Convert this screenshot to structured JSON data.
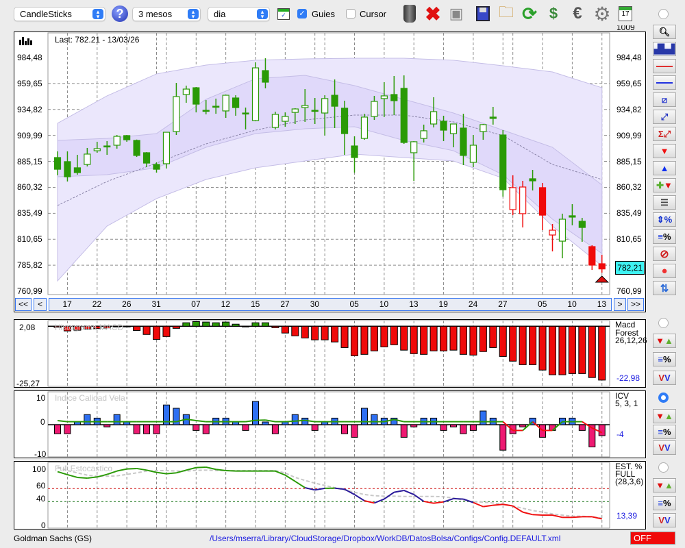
{
  "toolbar": {
    "chart_type": "CandleSticks",
    "period": "3 mesos",
    "interval": "dia",
    "guides_label": "Guies",
    "guides_checked": true,
    "cursor_label": "Cursor",
    "cursor_checked": false,
    "icons": [
      "help-icon",
      "chart-window-icon",
      "trash-icon",
      "delete-icon",
      "lamp-icon",
      "save-icon",
      "folder-icon",
      "refresh-icon",
      "sync-icon",
      "euro-icon",
      "gear-icon",
      "calendar-icon"
    ],
    "calendar_day": "17"
  },
  "main": {
    "last_label": "Last: 782.21 - 13/03/26",
    "top_tick": "1009",
    "y_ticks": [
      "984,48",
      "959,65",
      "934,82",
      "909,99",
      "885,15",
      "860,32",
      "835,49",
      "810,65",
      "785,82",
      "760,99"
    ],
    "y_tick_values": [
      984.48,
      959.65,
      934.82,
      909.99,
      885.15,
      860.32,
      835.49,
      810.65,
      785.82,
      760.99
    ],
    "current_price": "782,21",
    "colors": {
      "green": "#2a9a06",
      "red": "#f00a0a",
      "band_outer": "#ebe7fc",
      "band_inner": "#e0d9fa",
      "band_line": "#c4bde6"
    }
  },
  "nav": {
    "first": "<<",
    "prev": "<",
    "next": ">",
    "last": ">>",
    "dates": [
      "17",
      "22",
      "26",
      "31",
      "07",
      "12",
      "15",
      "27",
      "30",
      "05",
      "10",
      "13",
      "19",
      "24",
      "27",
      "05",
      "10",
      "13"
    ],
    "date_candles": [
      1,
      4,
      7,
      10,
      14,
      17,
      20,
      23,
      26,
      30,
      33,
      36,
      39,
      42,
      45,
      49,
      52,
      55
    ],
    "month_starts": [
      11,
      27,
      46
    ]
  },
  "candles": [
    [
      888.8,
      894.7,
      871.8,
      877.6,
      "g"
    ],
    [
      884.9,
      894.7,
      865.9,
      870.4,
      "g"
    ],
    [
      879.0,
      891.4,
      872.4,
      874.4,
      "g"
    ],
    [
      882.2,
      898.0,
      880.3,
      892.1,
      "g"
    ],
    [
      895.3,
      903.9,
      893.4,
      897.3,
      "g"
    ],
    [
      899.9,
      904.5,
      891.4,
      899.3,
      "g"
    ],
    [
      900.6,
      910.4,
      897.3,
      909.1,
      "g"
    ],
    [
      909.8,
      910.4,
      903.9,
      905.8,
      "g"
    ],
    [
      905.2,
      906.0,
      889.4,
      890.8,
      "g"
    ],
    [
      893.4,
      894.0,
      879.6,
      883.5,
      "g"
    ],
    [
      882.2,
      884.2,
      874.4,
      877.6,
      "g"
    ],
    [
      882.9,
      913.0,
      878.3,
      913.0,
      "g"
    ],
    [
      913.7,
      960.2,
      910.4,
      947.1,
      "g"
    ],
    [
      949.1,
      957.6,
      941.2,
      954.3,
      "g"
    ],
    [
      955.6,
      956.3,
      932.0,
      939.9,
      "g"
    ],
    [
      934.0,
      943.8,
      930.1,
      933.4,
      "g"
    ],
    [
      937.9,
      945.2,
      930.7,
      937.3,
      "g"
    ],
    [
      933.4,
      949.1,
      926.8,
      948.4,
      "g"
    ],
    [
      945.8,
      948.4,
      928.8,
      936.6,
      "g"
    ],
    [
      931.4,
      936.6,
      915.7,
      930.7,
      "g"
    ],
    [
      924.2,
      979.9,
      923.5,
      974.6,
      "g"
    ],
    [
      972.0,
      983.8,
      955.0,
      960.9,
      "g"
    ],
    [
      917.6,
      932.7,
      915.7,
      930.1,
      "g"
    ],
    [
      923.5,
      932.0,
      918.3,
      928.1,
      "g"
    ],
    [
      932.0,
      936.0,
      920.9,
      935.3,
      "g"
    ],
    [
      936.6,
      954.3,
      922.9,
      938.6,
      "g"
    ],
    [
      934.0,
      945.8,
      920.9,
      933.4,
      "g"
    ],
    [
      931.4,
      948.4,
      909.8,
      945.2,
      "g"
    ],
    [
      948.4,
      963.5,
      917.0,
      937.9,
      "g"
    ],
    [
      936.0,
      943.2,
      891.4,
      911.7,
      "g"
    ],
    [
      899.9,
      909.1,
      874.4,
      888.8,
      "g"
    ],
    [
      907.1,
      930.7,
      905.8,
      927.5,
      "g"
    ],
    [
      928.1,
      947.8,
      924.8,
      942.5,
      "g"
    ],
    [
      945.2,
      960.9,
      927.5,
      947.8,
      "g"
    ],
    [
      949.1,
      966.8,
      929.4,
      943.2,
      "g"
    ],
    [
      955.0,
      967.4,
      901.9,
      903.2,
      "g"
    ],
    [
      893.4,
      904.5,
      866.5,
      903.9,
      "g"
    ],
    [
      907.1,
      920.3,
      903.2,
      914.4,
      "g"
    ],
    [
      920.9,
      946.5,
      917.6,
      932.7,
      "g"
    ],
    [
      923.5,
      928.8,
      904.5,
      915.0,
      "g"
    ],
    [
      911.7,
      920.9,
      898.6,
      920.9,
      "g"
    ],
    [
      917.0,
      930.7,
      881.6,
      890.8,
      "g"
    ],
    [
      884.2,
      910.4,
      879.6,
      900.6,
      "g"
    ],
    [
      913.7,
      920.9,
      905.8,
      920.3,
      "g"
    ],
    [
      927.5,
      937.3,
      920.3,
      926.2,
      "g"
    ],
    [
      910.4,
      915.0,
      851.4,
      858.0,
      "g"
    ],
    [
      839.0,
      871.8,
      833.7,
      860.0,
      "r"
    ],
    [
      835.1,
      866.5,
      821.9,
      860.6,
      "r"
    ],
    [
      868.5,
      877.0,
      857.3,
      866.5,
      "g"
    ],
    [
      860.0,
      864.5,
      819.3,
      833.7,
      "r"
    ],
    [
      814.7,
      825.2,
      799.0,
      819.3,
      "r"
    ],
    [
      808.8,
      835.1,
      792.4,
      829.8,
      "g"
    ],
    [
      833.1,
      844.2,
      823.9,
      831.8,
      "g"
    ],
    [
      827.8,
      831.1,
      808.2,
      821.9,
      "g"
    ],
    [
      803.6,
      804.9,
      781.3,
      785.9,
      "r"
    ],
    [
      787.2,
      795.7,
      778.7,
      782.2,
      "r"
    ]
  ],
  "bands": {
    "sample_every": 5,
    "outer_upper": [
      921.6,
      947.8,
      968.8,
      977.3,
      981.9,
      983.2,
      983.8,
      983.8,
      981.9,
      976.6,
      970.7,
      955.6
    ],
    "inner_upper": [
      905.2,
      907.1,
      911.7,
      944.5,
      964.2,
      967.4,
      957.6,
      944.5,
      931.4,
      915.0,
      898.6,
      862.6
    ],
    "middle": [
      842.9,
      865.9,
      883.5,
      901.9,
      915.0,
      924.8,
      929.4,
      929.4,
      922.9,
      909.8,
      882.2,
      867.8
    ],
    "inner_lower": [
      870.4,
      872.4,
      879.0,
      898.6,
      911.7,
      916.3,
      918.3,
      905.2,
      895.3,
      872.4,
      829.8,
      797.0
    ],
    "outer_lower": [
      770.8,
      823.2,
      849.5,
      867.8,
      879.0,
      885.5,
      892.1,
      888.8,
      885.5,
      869.1,
      823.2,
      785.2
    ]
  },
  "macd": {
    "title": "Histograma MACD",
    "name1": "Macd",
    "name2": "Forest",
    "params": "26,12,26",
    "value": "-22,98",
    "y_max": "2,08",
    "y_min": "-25,27",
    "histogram": [
      -0.5,
      -2.0,
      -1.7,
      -1.2,
      -1.0,
      -0.8,
      -0.3,
      -0.2,
      -1.8,
      -3.5,
      -5.6,
      -4.4,
      -0.9,
      1.5,
      2.0,
      1.8,
      1.5,
      1.8,
      0.9,
      -0.3,
      1.5,
      1.5,
      -0.6,
      -2.9,
      -4.1,
      -5.0,
      -5.8,
      -5.8,
      -6.7,
      -9.1,
      -12.6,
      -12.0,
      -10.5,
      -8.8,
      -7.9,
      -10.2,
      -11.7,
      -12.0,
      -10.5,
      -10.5,
      -10.2,
      -12.0,
      -12.3,
      -10.8,
      -9.1,
      -12.9,
      -14.9,
      -16.4,
      -16.4,
      -18.7,
      -20.7,
      -20.7,
      -20.2,
      -20.2,
      -21.9,
      -22.98
    ]
  },
  "icv": {
    "title": "Indice Calidad Vela",
    "name": "ICV",
    "params": "5, 3, 1",
    "value": "-4",
    "y_ticks": [
      "10",
      "0",
      "-10"
    ],
    "bars": [
      -3.3,
      -3.3,
      1,
      3.7,
      2.4,
      -0.8,
      3.7,
      1,
      -3.3,
      -3.3,
      -3.3,
      7.2,
      6,
      3.7,
      -2.1,
      -3.3,
      2.4,
      2.4,
      1,
      -2.1,
      8.5,
      1,
      -3.3,
      1,
      3.7,
      2.4,
      -2.1,
      1,
      2.4,
      -3.3,
      -4.6,
      6,
      3.7,
      2.4,
      2.4,
      -4.6,
      -0.8,
      2.4,
      2.4,
      -2.1,
      -0.8,
      -3.3,
      -2.1,
      5,
      2.4,
      -9.3,
      -3.3,
      -0.8,
      2.4,
      -4.6,
      -2.1,
      2.4,
      2.4,
      -2.1,
      -8.1,
      -4
    ],
    "signal": [
      1.5,
      1.1,
      1.1,
      1.1,
      1.1,
      1.1,
      1.1,
      1.1,
      1.1,
      1.1,
      1.1,
      1.1,
      1.1,
      2.0,
      1.5,
      1.1,
      1.1,
      1.1,
      1.1,
      1.1,
      1.6,
      1.7,
      1.1,
      1.1,
      1.3,
      1.6,
      1.1,
      1.1,
      1.1,
      1.1,
      1.1,
      1.1,
      1.1,
      1.1,
      1.9,
      1.1,
      1.1,
      1.1,
      1.1,
      1.1,
      1.1,
      1.1,
      1.1,
      1.1,
      1.1,
      1.1,
      -2.1,
      -2.1,
      1.1,
      -2.1,
      -2.1,
      1.1,
      1.1,
      1.1,
      -1.2,
      -2.9
    ],
    "colors": {
      "up": "#2e6ff2",
      "down": "#ee1a72"
    }
  },
  "stoch": {
    "title": "Full Estocastico",
    "name1": "EST. %",
    "name2": "FULL",
    "params": "(28,3,6)",
    "value": "13,39",
    "y_ticks": [
      "100",
      "60",
      "40",
      "0"
    ],
    "k": [
      86,
      81.4,
      77.2,
      76.1,
      77.9,
      81.8,
      87,
      90.2,
      90.9,
      88.4,
      84.9,
      82.8,
      84.2,
      88.4,
      92.3,
      93,
      89.5,
      87.7,
      87,
      87,
      87,
      87,
      87,
      80.7,
      71.2,
      61.4,
      57.9,
      60.4,
      60.7,
      59,
      50.9,
      41.4,
      37.9,
      43.9,
      54.4,
      57.2,
      50.9,
      40.4,
      37.5,
      39.6,
      44.6,
      43.9,
      38.6,
      32.3,
      34.4,
      35.8,
      33.3,
      23.9,
      20,
      19.3,
      19.3,
      15.8,
      15.8,
      16.8,
      16.8,
      13.4
    ],
    "d": [
      93,
      87.7,
      84.2,
      80.7,
      79,
      79,
      79.6,
      81.8,
      84.2,
      87,
      87.7,
      87.7,
      87,
      87,
      88,
      88.4,
      87.7,
      87.7,
      87.7,
      87.7,
      87.7,
      87.7,
      87.7,
      84,
      77.2,
      72.6,
      68.4,
      64.9,
      61.4,
      57.9,
      54.4,
      50.9,
      49.1,
      48.4,
      48.4,
      48,
      48,
      48,
      48,
      47.4,
      45.6,
      42.1,
      39.6,
      39.3,
      37.9,
      36.1,
      33.3,
      29.8,
      26.3,
      23.9,
      21.1,
      19.3,
      17.5,
      17.5,
      16.5,
      14.7
    ]
  },
  "status": {
    "ticker": "Goldman Sachs (GS)",
    "config_path": "/Users/mserra/Library/CloudStorage/Dropbox/WorkDB/DatosBolsa/Configs/Config.DEFAULT.xml",
    "live": "OFF"
  }
}
